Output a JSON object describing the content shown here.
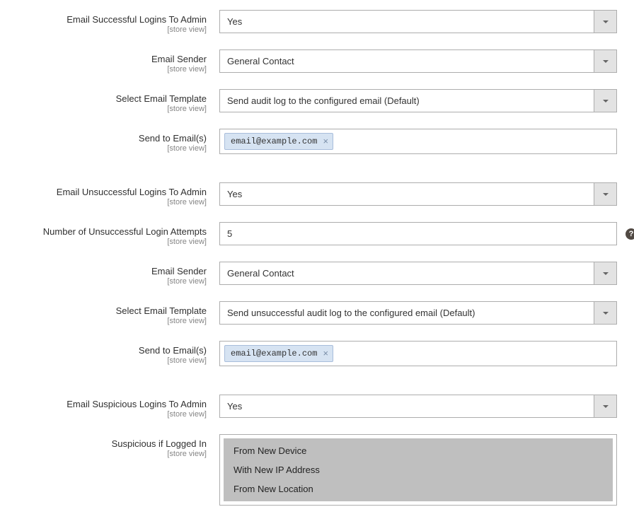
{
  "scope_label": "[store view]",
  "fields": {
    "email_success": {
      "label": "Email Successful Logins To Admin",
      "value": "Yes"
    },
    "sender1": {
      "label": "Email Sender",
      "value": "General Contact"
    },
    "template1": {
      "label": "Select Email Template",
      "value": "Send audit log to the configured email (Default)"
    },
    "emails1": {
      "label": "Send to Email(s)",
      "tag": "email@example.com"
    },
    "email_unsuccess": {
      "label": "Email Unsuccessful Logins To Admin",
      "value": "Yes"
    },
    "attempts": {
      "label": "Number of Unsuccessful Login Attempts",
      "value": "5"
    },
    "sender2": {
      "label": "Email Sender",
      "value": "General Contact"
    },
    "template2": {
      "label": "Select Email Template",
      "value": "Send unsuccessful audit log to the configured email (Default)"
    },
    "emails2": {
      "label": "Send to Email(s)",
      "tag": "email@example.com"
    },
    "email_suspicious": {
      "label": "Email Suspicious Logins To Admin",
      "value": "Yes"
    },
    "suspicious_if": {
      "label": "Suspicious if Logged In",
      "options": {
        "0": "From New Device",
        "1": "With New IP Address",
        "2": "From New Location"
      }
    }
  }
}
